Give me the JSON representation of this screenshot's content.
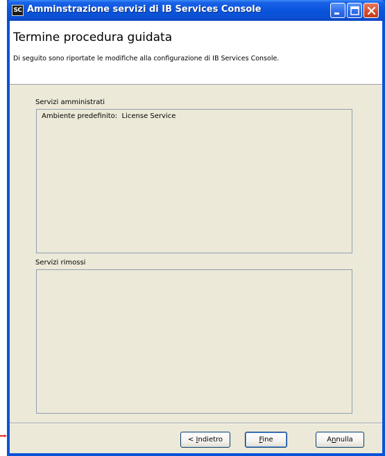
{
  "window": {
    "icon_text": "SC",
    "title": "Amminstrazione servizi di IB Services Console",
    "controls": [
      "minimize-icon",
      "maximize-icon",
      "close-icon"
    ]
  },
  "header": {
    "title": "Termine procedura guidata",
    "description": "Di seguito sono riportate le modifiche alla configurazione di IB Services Console."
  },
  "managed_services": {
    "label": "Servizi amministrati",
    "items": [
      "Ambiente predefinito:  License Service"
    ]
  },
  "removed_services": {
    "label": "Servizi rimossi",
    "items": []
  },
  "buttons": {
    "back": {
      "prefix": "< ",
      "mnemonic": "I",
      "rest": "ndietro"
    },
    "finish": {
      "mnemonic": "F",
      "rest": "ine"
    },
    "cancel": {
      "prefix": "A",
      "mnemonic": "n",
      "rest": "nulla"
    }
  },
  "colors": {
    "titlebar": "#0a55dd",
    "dialog_bg": "#ece9d8",
    "pointer_arrow": "#e03020"
  }
}
